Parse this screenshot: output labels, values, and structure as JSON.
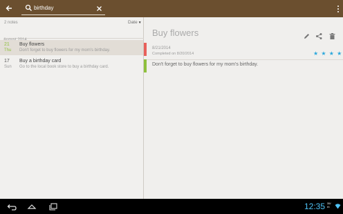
{
  "search": {
    "value": "birthday"
  },
  "list": {
    "count_label": "2 notes",
    "sort_label": "Date",
    "section_label": "August 2014",
    "notes": [
      {
        "day": "21",
        "weekday": "Thu",
        "title": "Buy flowers",
        "excerpt": "Don't forget to buy flowers for my mom's birthday."
      },
      {
        "day": "17",
        "weekday": "Sun",
        "title": "Buy a birthday card",
        "excerpt": "Go to the local book store to buy a birthday card."
      }
    ]
  },
  "detail": {
    "title": "Buy flowers",
    "date": "8/21/2014",
    "completed": "Completed on 8/20/2014",
    "rating": 4,
    "stars_text": "★ ★ ★ ★",
    "body": "Don't forget to buy flowers for my mom's birthday."
  },
  "status": {
    "time": "12:35",
    "small_top": "35/",
    "small_bottom": "rb"
  },
  "colors": {
    "topbar": "#6b4f2f",
    "accent_green": "#8ec03c",
    "accent_red": "#e8605a",
    "star_blue": "#2aa7dc",
    "clock_blue": "#4fc3f7"
  },
  "icons": [
    "back-arrow-icon",
    "search-icon",
    "close-icon",
    "overflow-menu-icon",
    "edit-pencil-icon",
    "share-icon",
    "trash-icon",
    "star-icon",
    "nav-back-icon",
    "nav-home-icon",
    "nav-recents-icon",
    "wifi-icon"
  ]
}
